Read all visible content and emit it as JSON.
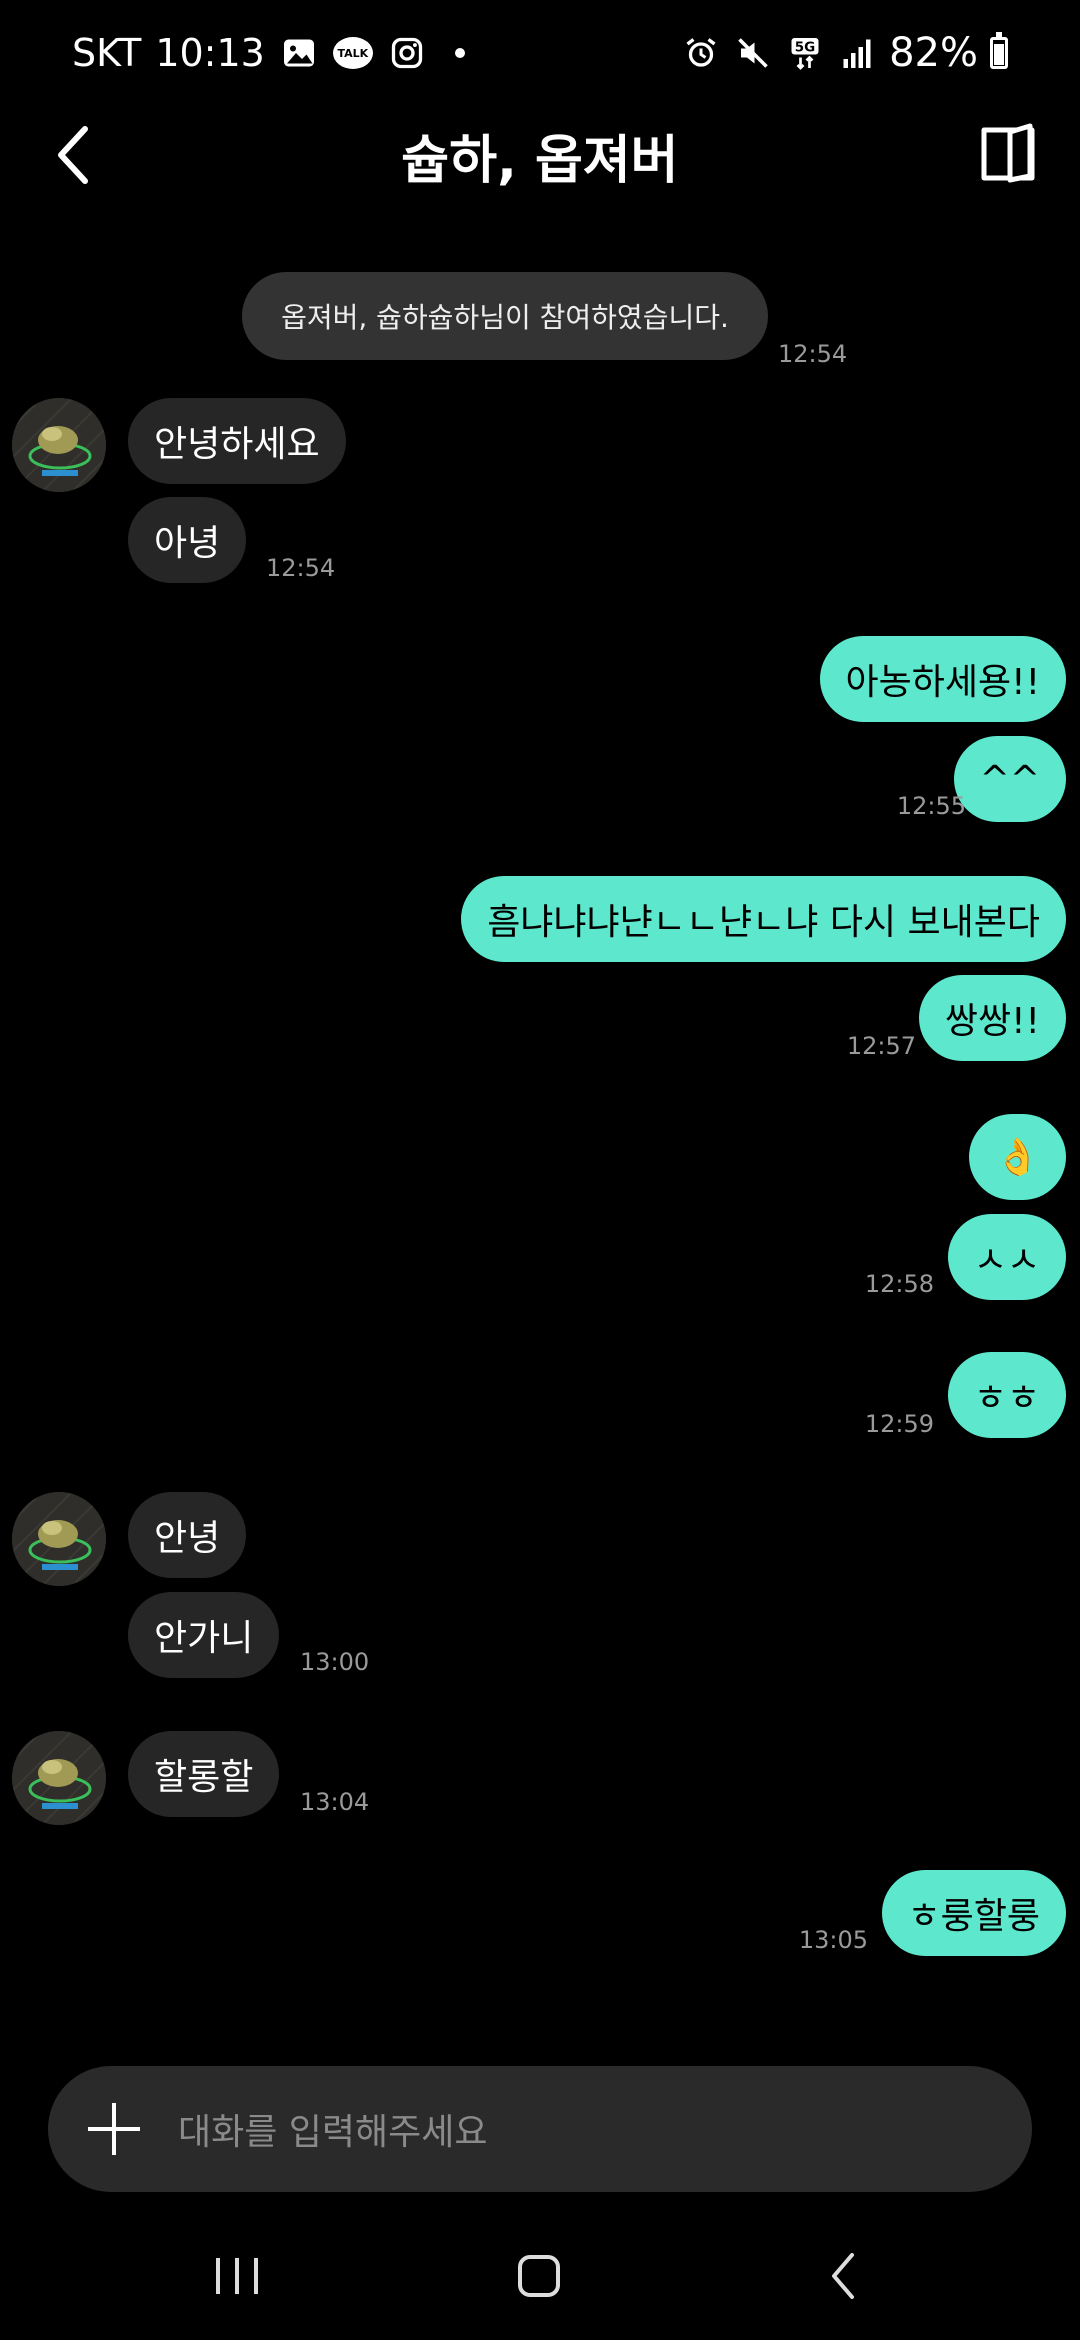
{
  "status_bar": {
    "carrier": "SKT",
    "time": "10:13",
    "talk_icon_text": "TALK",
    "battery": "82%",
    "battery_level": 0.82,
    "network": "5G"
  },
  "header": {
    "title": "슙하, 옵져버"
  },
  "system_message": {
    "text": "옵져버, 슙하슙하님이 참여하였습니다.",
    "time": "12:54"
  },
  "messages": {
    "m1": {
      "text": "안녕하세요"
    },
    "m2": {
      "text": "아녕",
      "time": "12:54"
    },
    "m3": {
      "text": "아농하세용!!"
    },
    "m4": {
      "text": "^^",
      "time": "12:55"
    },
    "m5": {
      "text": "흠냐냐냐냔ㄴㄴ냔ㄴ냐 다시 보내본다"
    },
    "m6": {
      "text": "쌍쌍!!",
      "time": "12:57"
    },
    "m7": {
      "text": "👌"
    },
    "m8": {
      "text": "ㅅㅅ",
      "time": "12:58"
    },
    "m9": {
      "text": "ㅎㅎ",
      "time": "12:59"
    },
    "m10": {
      "text": "안녕"
    },
    "m11": {
      "text": "안가니",
      "time": "13:00"
    },
    "m12": {
      "text": "할롱할",
      "time": "13:04"
    },
    "m13": {
      "text": "ㅎ룽할룽",
      "time": "13:05"
    }
  },
  "input": {
    "placeholder": "대화를 입력해주세요"
  },
  "colors": {
    "outgoing_bubble": "#5de8cd",
    "incoming_bubble": "#262626",
    "background": "#000000"
  }
}
